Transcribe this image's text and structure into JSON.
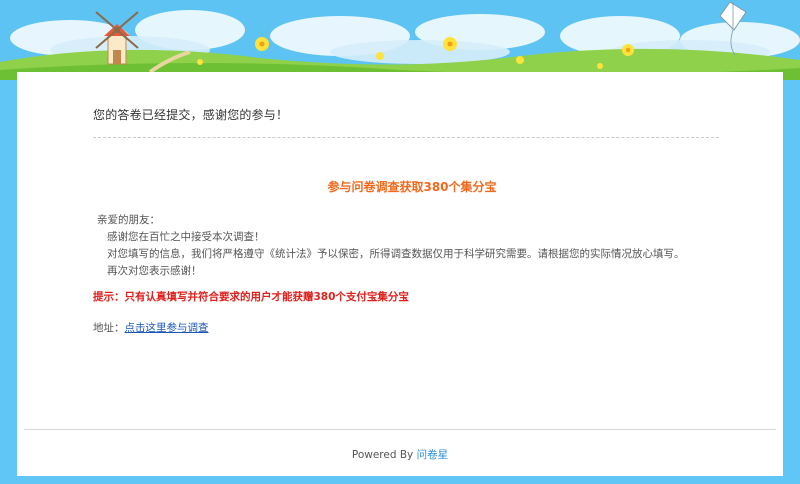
{
  "header": {
    "scene_icons": [
      "windmill-icon",
      "kite-icon",
      "flower-icon",
      "cloud-icon"
    ]
  },
  "message": {
    "submitted": "您的答卷已经提交，感谢您的参与！"
  },
  "promo": {
    "title": "参与问卷调查获取380个集分宝",
    "greeting": "亲爱的朋友：",
    "lines": [
      "感谢您在百忙之中接受本次调查！",
      "对您填写的信息，我们将严格遵守《统计法》予以保密，所得调查数据仅用于科学研究需要。请根据您的实际情况放心填写。",
      "再次对您表示感谢！"
    ],
    "hint": "提示：只有认真填写并符合要求的用户才能获赠380个支付宝集分宝",
    "address_label": "地址：",
    "address_link": "点击这里参与调查"
  },
  "footer": {
    "powered_by": "Powered By",
    "brand": "问卷星"
  },
  "colors": {
    "background": "#60c6f5",
    "accent_orange": "#f06a1e",
    "hint_red": "#e0201c",
    "link_blue": "#1a57b8",
    "brand_blue": "#2c8fd6"
  }
}
